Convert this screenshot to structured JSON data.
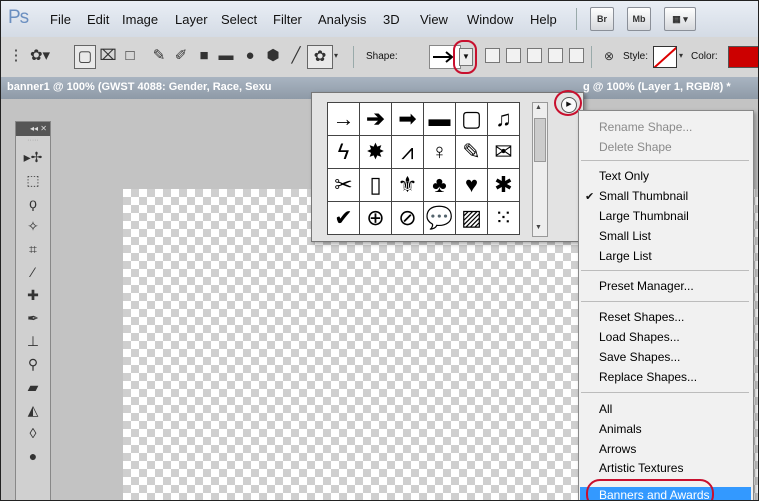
{
  "app": {
    "logo": "Ps"
  },
  "menubar": {
    "items": [
      "File",
      "Edit",
      "Image",
      "Layer",
      "Select",
      "Filter",
      "Analysis",
      "3D",
      "View",
      "Window",
      "Help"
    ],
    "bridge": "Br",
    "minibridge": "Mb"
  },
  "options": {
    "shape_label": "Shape:",
    "style_label": "Style:",
    "color_label": "Color:",
    "color_value": "#c00000"
  },
  "doc_tabs": {
    "left": "banner1 @ 100% (GWST 4088: Gender, Race, Sexu",
    "right": "g @ 100% (Layer 1, RGB/8) *"
  },
  "picker": {
    "shapes": [
      "arrow-thin",
      "arrow-medium",
      "arrow-bold",
      "banner-wave",
      "frame-square",
      "music-note",
      "lightning",
      "starburst",
      "grass",
      "lightbulb",
      "thumbtack",
      "envelope",
      "scissors",
      "blank-tile",
      "fleur-de-lis",
      "puzzle-cluster",
      "heart",
      "splat",
      "checkmark",
      "crosshair",
      "no-sign",
      "speech-bubble",
      "hatch-pattern",
      "dot-grid"
    ]
  },
  "menu": {
    "items": [
      {
        "label": "Rename Shape...",
        "disabled": true
      },
      {
        "label": "Delete Shape",
        "disabled": true
      },
      {
        "label": "Text Only"
      },
      {
        "label": "Small Thumbnail",
        "checked": true
      },
      {
        "label": "Large Thumbnail"
      },
      {
        "label": "Small List"
      },
      {
        "label": "Large List"
      },
      {
        "label": "Preset Manager..."
      },
      {
        "label": "Reset Shapes..."
      },
      {
        "label": "Load Shapes..."
      },
      {
        "label": "Save Shapes..."
      },
      {
        "label": "Replace Shapes..."
      },
      {
        "label": "All"
      },
      {
        "label": "Animals"
      },
      {
        "label": "Arrows"
      },
      {
        "label": "Artistic Textures"
      },
      {
        "label": "Banners and Awards",
        "highlighted": true
      }
    ],
    "checkmark": "✔"
  },
  "accent": {
    "highlight": "#3399ff",
    "annotation": "#c8102e"
  }
}
